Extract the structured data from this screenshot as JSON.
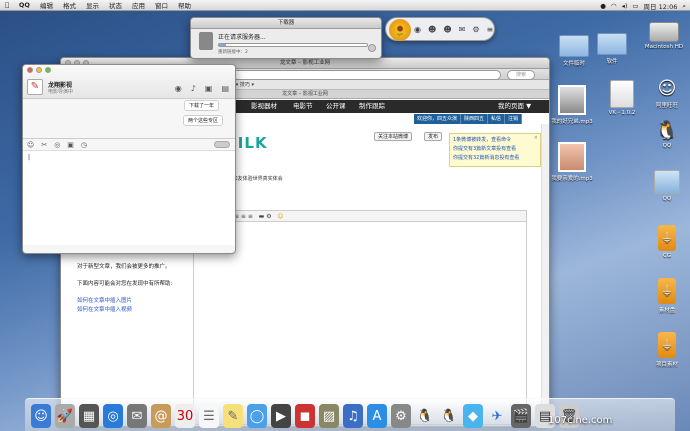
{
  "menubar": {
    "apple": "",
    "app": "QQ",
    "items": [
      "编辑",
      "格式",
      "显示",
      "状态",
      "应用",
      "窗口",
      "帮助"
    ],
    "clock": "周日 12:06"
  },
  "desktop": {
    "icons": [
      {
        "label": "文件临时"
      },
      {
        "label": "软件"
      },
      {
        "label": "Macintosh HD"
      },
      {
        "label": "我的好兄弟.mp3"
      },
      {
        "label": "VK - 1.0.2"
      },
      {
        "label": "阿里旺旺"
      },
      {
        "label": "QQ"
      },
      {
        "label": "我要亲爱的.mp3"
      },
      {
        "label": "QQ"
      },
      {
        "label": "CG"
      },
      {
        "label": "素材盘"
      },
      {
        "label": "项目素材"
      }
    ]
  },
  "download": {
    "title": "下载器",
    "status": "正在请求服务器...",
    "sub": "重新链接中：2"
  },
  "browser": {
    "title": "龙文章 – 影视工业网",
    "tab": "龙文章 – 影视工业网",
    "search_placeholder": "搜索",
    "bookmarks": "应用商店    新闻    影响 ▾    技巧 ▾",
    "nav": [
      "影视器材",
      "电影节",
      "公开课",
      "制作跟踪",
      "我的页面 ▼"
    ],
    "blue_links": [
      "欢迎你，四五众演",
      "陕西四五",
      "私信",
      "注销"
    ],
    "logo": "SILK",
    "follow_btn": "关注本站微博",
    "publish_btn": "发布",
    "notices": [
      "1条微博被转发，查看命令",
      "你提交有3篇新文章投有查看",
      "你提交有32篇新消息投有查看"
    ],
    "infoline": "评  和友体验世界真实体会",
    "sidebar_lines": [
      "对于新型文章，我们会被更多的推广。",
      "下面内容可能会对您在发现中有所帮助:"
    ],
    "sidebar_links": [
      "如何在文章中插入图片",
      "如何在文章中插入视频"
    ]
  },
  "chat": {
    "name": "龙翔影视",
    "status": "电影导演中",
    "bubbles": [
      "下载了一年",
      "两个这些专区"
    ],
    "input": "|"
  },
  "watermark": "107cine.com"
}
